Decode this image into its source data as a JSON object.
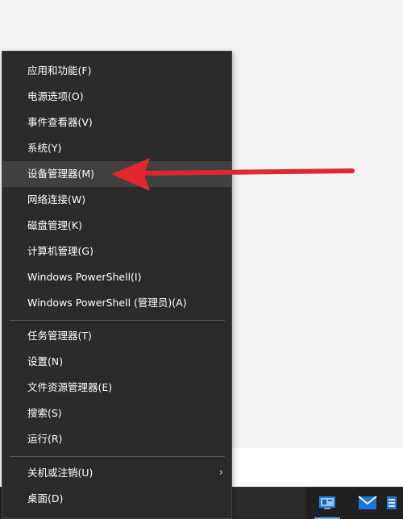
{
  "menu": {
    "group1": [
      {
        "label": "应用和功能(F)"
      },
      {
        "label": "电源选项(O)"
      },
      {
        "label": "事件查看器(V)"
      },
      {
        "label": "系统(Y)"
      },
      {
        "label": "设备管理器(M)"
      },
      {
        "label": "网络连接(W)"
      },
      {
        "label": "磁盘管理(K)"
      },
      {
        "label": "计算机管理(G)"
      },
      {
        "label": "Windows PowerShell(I)"
      },
      {
        "label": "Windows PowerShell (管理员)(A)"
      }
    ],
    "group2": [
      {
        "label": "任务管理器(T)"
      },
      {
        "label": "设置(N)"
      },
      {
        "label": "文件资源管理器(E)"
      },
      {
        "label": "搜索(S)"
      },
      {
        "label": "运行(R)"
      }
    ],
    "group3": [
      {
        "label": "关机或注销(U)",
        "submenu_indicator": "›"
      },
      {
        "label": "桌面(D)"
      }
    ],
    "highlighted_item": "设备管理器(M)"
  },
  "annotation": {
    "arrow_color": "#e0282e"
  },
  "taskbar": {
    "icons": [
      "control-panel-icon",
      "mail-icon",
      "app-icon"
    ]
  }
}
